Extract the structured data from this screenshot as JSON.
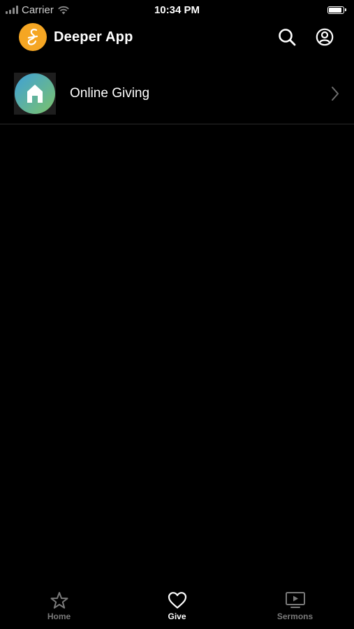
{
  "status_bar": {
    "carrier": "Carrier",
    "time": "10:34 PM",
    "battery_level": 0.9
  },
  "header": {
    "title": "Deeper App",
    "logo_color": "#f5a623",
    "icons": [
      "search-icon",
      "account-icon"
    ]
  },
  "list": {
    "items": [
      {
        "label": "Online Giving",
        "icon": "home-icon"
      }
    ]
  },
  "tab_bar": {
    "tabs": [
      {
        "label": "Home",
        "icon": "star-icon",
        "active": false
      },
      {
        "label": "Give",
        "icon": "heart-icon",
        "active": true
      },
      {
        "label": "Sermons",
        "icon": "tv-play-icon",
        "active": false
      }
    ]
  },
  "colors": {
    "background": "#000000",
    "tab_active": "#ffffff",
    "tab_inactive": "#7a7a7a",
    "accent": "#f5a623"
  }
}
